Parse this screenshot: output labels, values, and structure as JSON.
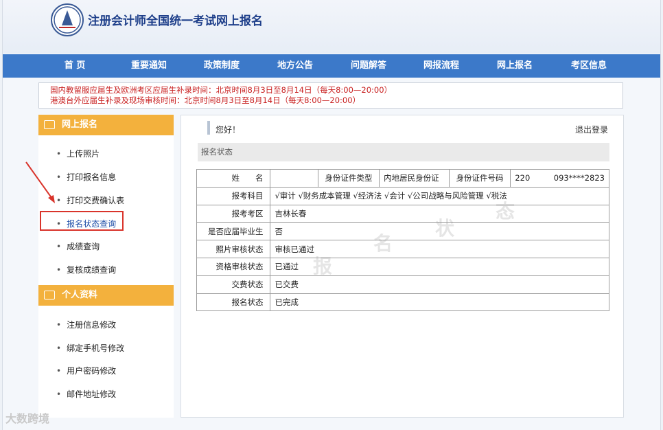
{
  "site": {
    "title": "注册会计师全国统一考试网上报名"
  },
  "nav": [
    "首 页",
    "重要通知",
    "政策制度",
    "地方公告",
    "问题解答",
    "网报流程",
    "网上报名",
    "考区信息"
  ],
  "notice": [
    "国内教留服应届生及欧洲考区应届生补录时间：北京时间8月3日至8月14日（每天8:00—20:00）",
    "港澳台外应届生补录及现场审核时间：北京时间8月3日至8月14日（每天8:00—20:00）"
  ],
  "sidebar": {
    "section1": "网上报名",
    "items1": [
      "上传照片",
      "打印报名信息",
      "打印交费确认表",
      "报名状态查询",
      "成绩查询",
      "复核成绩查询"
    ],
    "section2": "个人资料",
    "items2": [
      "注册信息修改",
      "绑定手机号修改",
      "用户密码修改",
      "邮件地址修改"
    ]
  },
  "content": {
    "greeting": "您好！",
    "logout": "退出登录",
    "status_title": "报名状态",
    "row1": {
      "name_label": "姓　　名",
      "name_value": "",
      "id_type_label": "身份证件类型",
      "id_type_value": "内地居民身份证",
      "id_no_label": "身份证件号码",
      "id_no_value": "220　　　093****2823"
    },
    "rows": [
      {
        "label": "报考科目",
        "value": "√审计 √财务成本管理 √经济法 √会计 √公司战略与风险管理 √税法"
      },
      {
        "label": "报考考区",
        "value": "吉林长春"
      },
      {
        "label": "是否应届毕业生",
        "value": "否"
      },
      {
        "label": "照片审核状态",
        "value": "审核已通过"
      },
      {
        "label": "资格审核状态",
        "value": "已通过"
      },
      {
        "label": "交费状态",
        "value": "已交费"
      },
      {
        "label": "报名状态",
        "value": "已完成"
      }
    ],
    "watermark": [
      "报",
      "名",
      "状",
      "态"
    ]
  },
  "brand": "大数跨境",
  "colors": {
    "nav": "#3c79c9",
    "sidebar_head": "#f3b13d",
    "notice_text": "#c81e1e",
    "highlight": "#d9342b"
  }
}
